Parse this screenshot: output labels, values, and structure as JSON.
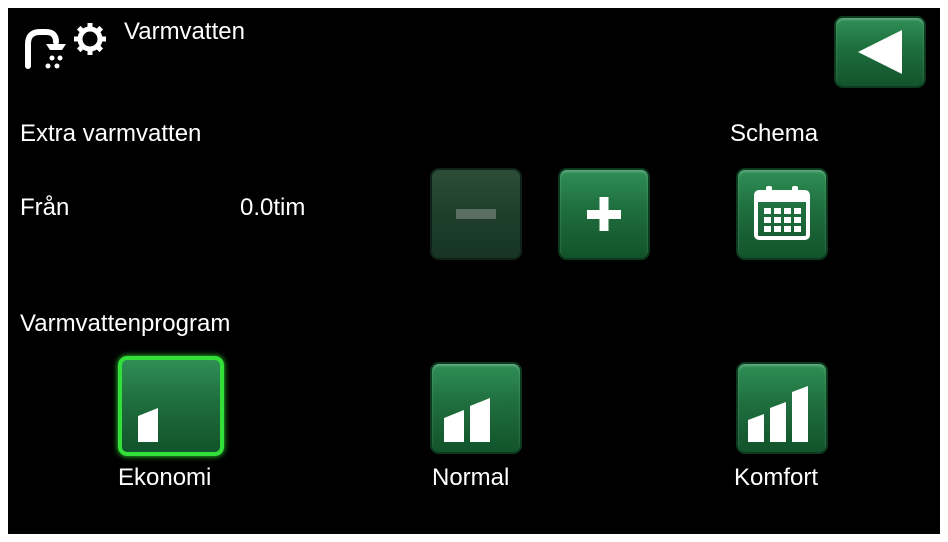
{
  "header": {
    "title": "Varmvatten",
    "app_icon": "hot-water-settings-icon",
    "back_icon": "back-arrow-icon"
  },
  "extra": {
    "heading": "Extra varmvatten",
    "from_label": "Från",
    "from_value": "0.0tim",
    "decrease_icon": "minus-icon",
    "increase_icon": "plus-icon",
    "decrease_enabled": false
  },
  "schedule": {
    "label": "Schema",
    "icon": "calendar-icon"
  },
  "program": {
    "heading": "Varmvattenprogram",
    "selected": "Ekonomi",
    "options": [
      {
        "label": "Ekonomi",
        "icon": "level-1-bars-icon"
      },
      {
        "label": "Normal",
        "icon": "level-2-bars-icon"
      },
      {
        "label": "Komfort",
        "icon": "level-3-bars-icon"
      }
    ]
  },
  "colors": {
    "background": "#000000",
    "button": "#1f6e3e",
    "selected_outline": "#33e03a",
    "text": "#ffffff"
  }
}
